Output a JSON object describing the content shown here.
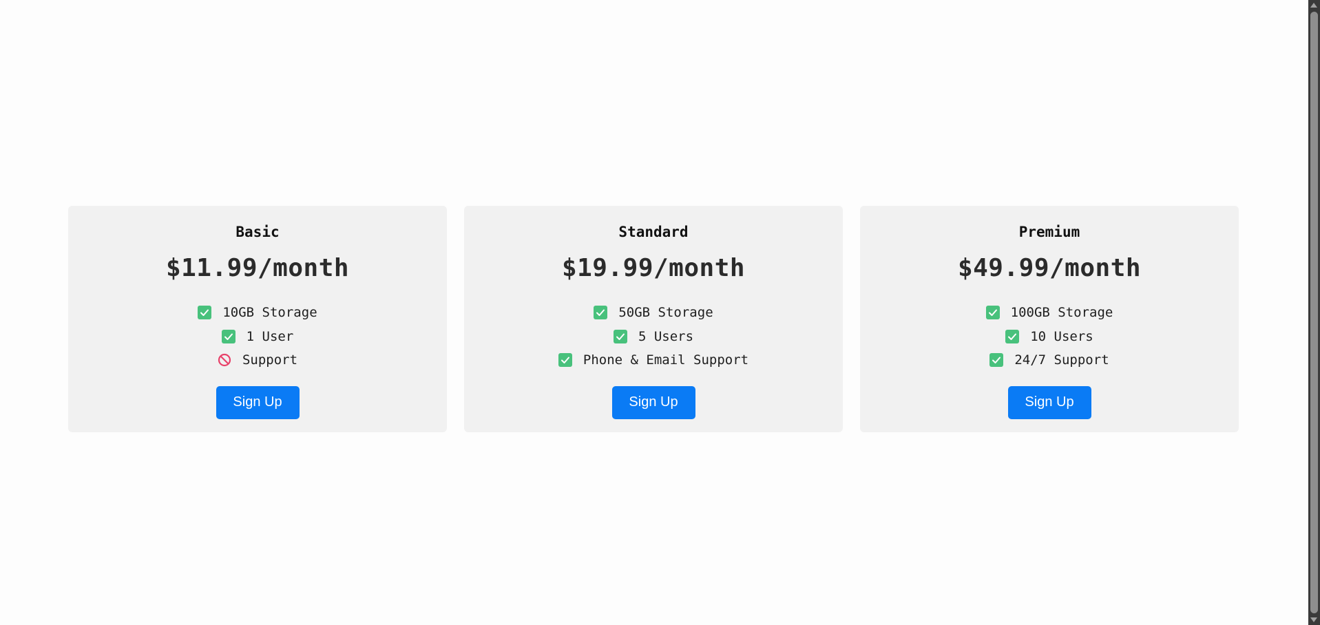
{
  "plans": [
    {
      "name": "Basic",
      "price": "$11.99/month",
      "features": [
        {
          "text": "10GB Storage",
          "icon": "check-icon",
          "included": true
        },
        {
          "text": "1 User",
          "icon": "check-icon",
          "included": true
        },
        {
          "text": "Support",
          "icon": "no-entry-icon",
          "included": false
        }
      ],
      "button_label": "Sign Up"
    },
    {
      "name": "Standard",
      "price": "$19.99/month",
      "features": [
        {
          "text": "50GB Storage",
          "icon": "check-icon",
          "included": true
        },
        {
          "text": "5 Users",
          "icon": "check-icon",
          "included": true
        },
        {
          "text": "Phone & Email Support",
          "icon": "check-icon",
          "included": true
        }
      ],
      "button_label": "Sign Up"
    },
    {
      "name": "Premium",
      "price": "$49.99/month",
      "features": [
        {
          "text": "100GB Storage",
          "icon": "check-icon",
          "included": true
        },
        {
          "text": "10 Users",
          "icon": "check-icon",
          "included": true
        },
        {
          "text": "24/7 Support",
          "icon": "check-icon",
          "included": true
        }
      ],
      "button_label": "Sign Up"
    }
  ],
  "colors": {
    "card_background": "#f1f1f1",
    "button": "#0a7bf5",
    "check": "#48c17c",
    "no_entry": "#e8426a"
  }
}
